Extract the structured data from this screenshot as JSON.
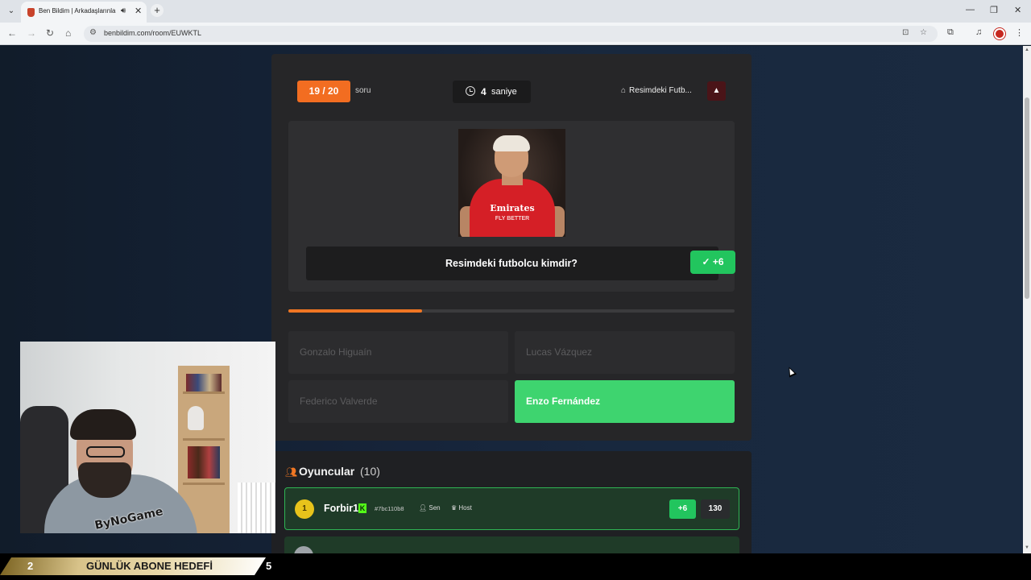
{
  "browser": {
    "tab_title": "Ben Bildim | Arkadaşlarınla",
    "url": "benbildim.com/room/EUWKTL",
    "icons": [
      "tab-list-icon",
      "audio-icon",
      "close-tab-icon",
      "new-tab-icon",
      "back-icon",
      "forward-icon",
      "reload-icon",
      "home-icon",
      "site-info-icon",
      "install-app-icon",
      "bookmark-star-icon",
      "extensions-icon",
      "media-control-icon",
      "profile-icon",
      "menu-icon",
      "minimize-icon",
      "restore-icon",
      "close-window-icon"
    ]
  },
  "quiz": {
    "counter": "19 / 20",
    "counter_label": "soru",
    "timer_value": "4",
    "timer_label": "saniye",
    "category": "Resimdeki Futb...",
    "question": "Resimdeki futbolcu kimdir?",
    "points_badge": "+6",
    "progress_fraction": 0.3,
    "image_text": {
      "sponsor": "Emirates",
      "slogan": "FLY BETTER"
    },
    "options": [
      {
        "label": "Gonzalo Higuaín",
        "state": "disabled"
      },
      {
        "label": "Lucas Vázquez",
        "state": "disabled"
      },
      {
        "label": "Federico Valverde",
        "state": "disabled"
      },
      {
        "label": "Enzo Fernández",
        "state": "correct"
      }
    ],
    "accent": "#f26d21",
    "correct_color": "#3ed46f"
  },
  "players": {
    "title": "Oyuncular",
    "count": "(10)",
    "list": [
      {
        "rank": "1",
        "name": "Forbir1",
        "id": "#7bc110b8",
        "you": "Sen",
        "role": "Host",
        "gain": "+6",
        "score": "130"
      }
    ]
  },
  "overlay": {
    "logo_text": "ByNoGame",
    "ticker_left": "2",
    "ticker_label": "GÜNLÜK ABONE HEDEFİ",
    "ticker_right": "5"
  }
}
